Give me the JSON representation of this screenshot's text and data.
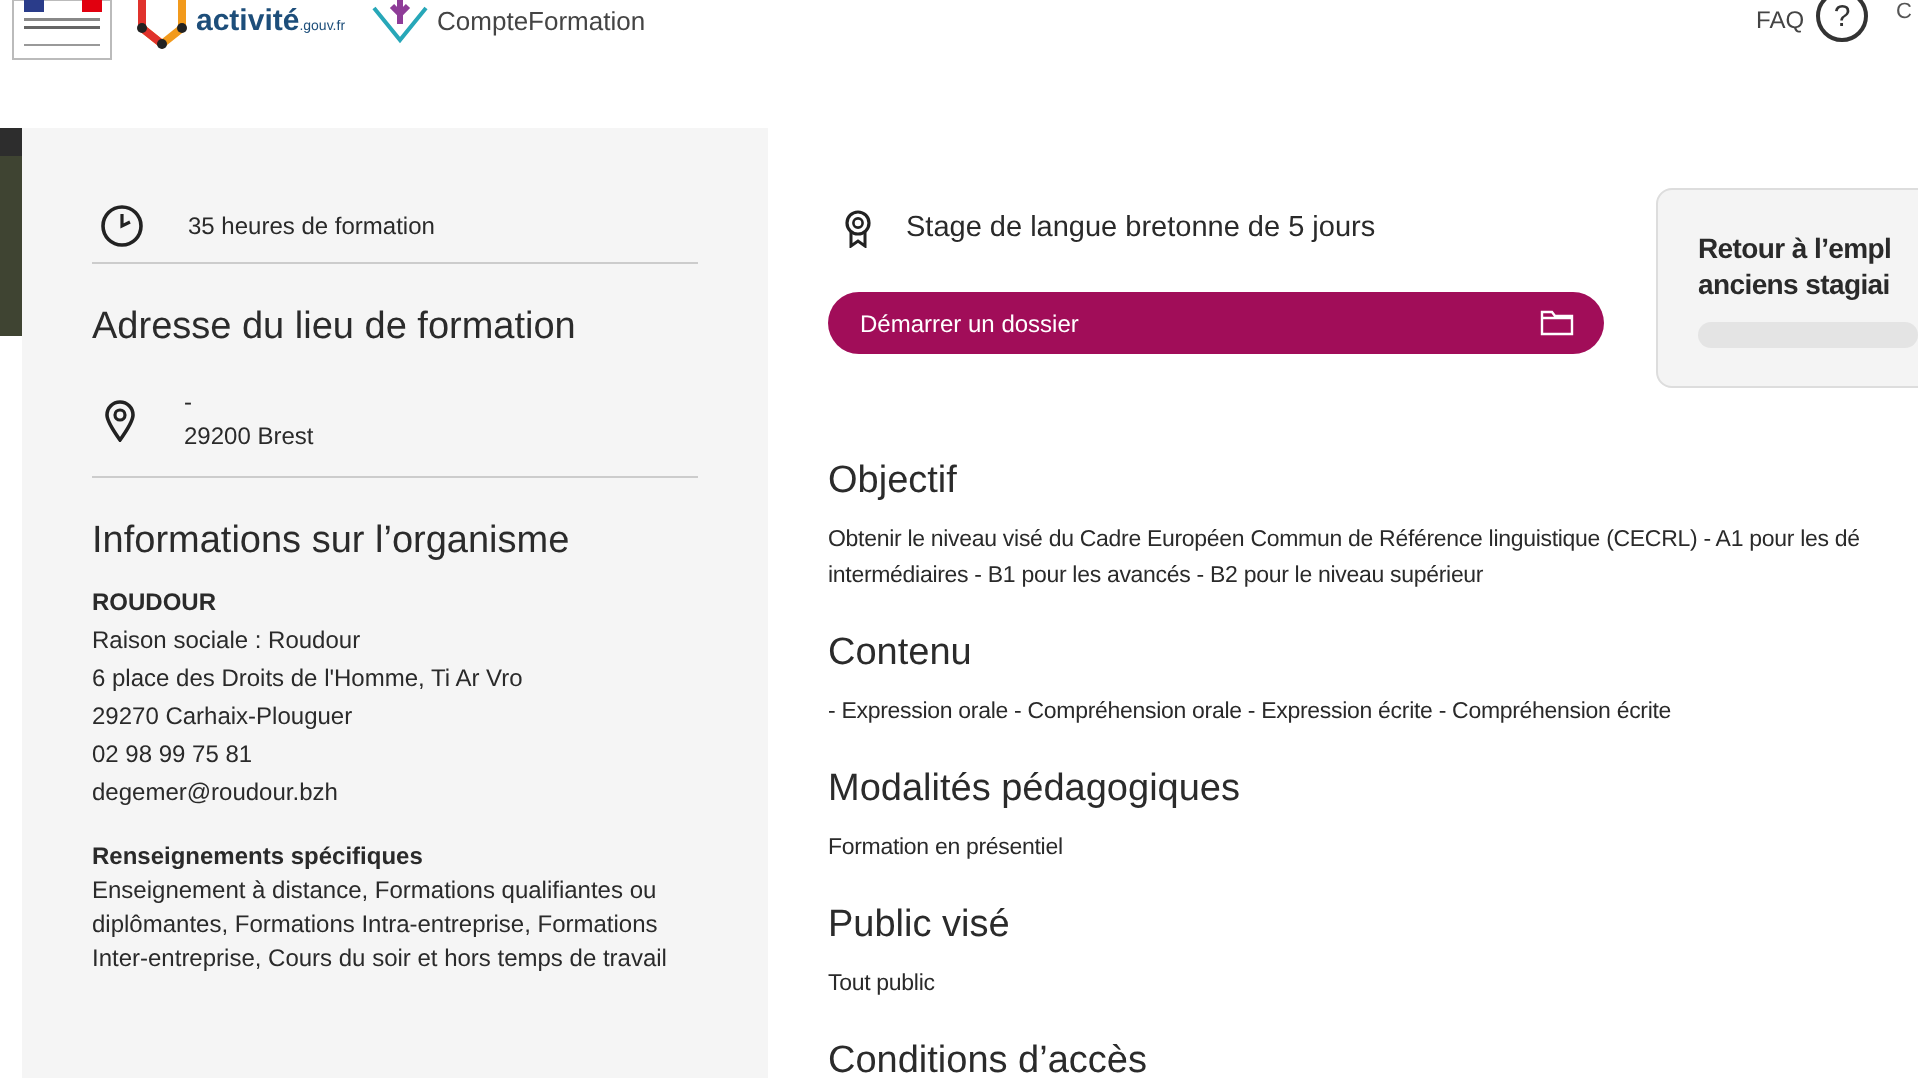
{
  "header": {
    "logos": [
      {
        "kind": "ministry"
      },
      {
        "kind": "activite",
        "text": "activité",
        "suffix": ".gouv.fr"
      },
      {
        "kind": "formation",
        "text": "CompteFormation"
      }
    ],
    "faq": "FAQ",
    "help": "?",
    "cut_link": "C"
  },
  "sidebar": {
    "duration": "35 heures de formation",
    "address_title": "Adresse du lieu de formation",
    "address_lines": [
      "-",
      "29200 Brest"
    ],
    "org_title": "Informations sur l’organisme",
    "org_name": "ROUDOUR",
    "org_lines": [
      "Raison sociale : Roudour",
      "6 place des Droits de l'Homme, Ti Ar Vro",
      "29270 Carhaix-Plouguer",
      "02 98 99 75 81",
      "degemer@roudour.bzh"
    ],
    "specific_title": "Renseignements spécifiques",
    "specific_text": "Enseignement à distance, Formations qualifiantes ou diplômantes, Formations Intra-entreprise, Formations Inter-entreprise, Cours du soir et hors temps de travail"
  },
  "main": {
    "title": "Stage de langue bretonne de 5 jours",
    "start_button": "Démarrer un dossier",
    "sections": [
      {
        "heading": "Objectif",
        "lines": [
          "Obtenir le niveau visé du Cadre Européen Commun de Référence linguistique (CECRL) - A1 pour les dé",
          "intermédiaires - B1 pour les avancés - B2 pour le niveau supérieur"
        ]
      },
      {
        "heading": "Contenu",
        "lines": [
          "- Expression orale - Compréhension orale - Expression écrite - Compréhension écrite"
        ]
      },
      {
        "heading": "Modalités pédagogiques",
        "lines": [
          "Formation en présentiel"
        ]
      },
      {
        "heading": "Public visé",
        "lines": [
          "Tout public"
        ]
      },
      {
        "heading": "Conditions d’accès"
      }
    ]
  },
  "card": {
    "title_lines": [
      "Retour à l’empl",
      "anciens stagiai"
    ]
  }
}
